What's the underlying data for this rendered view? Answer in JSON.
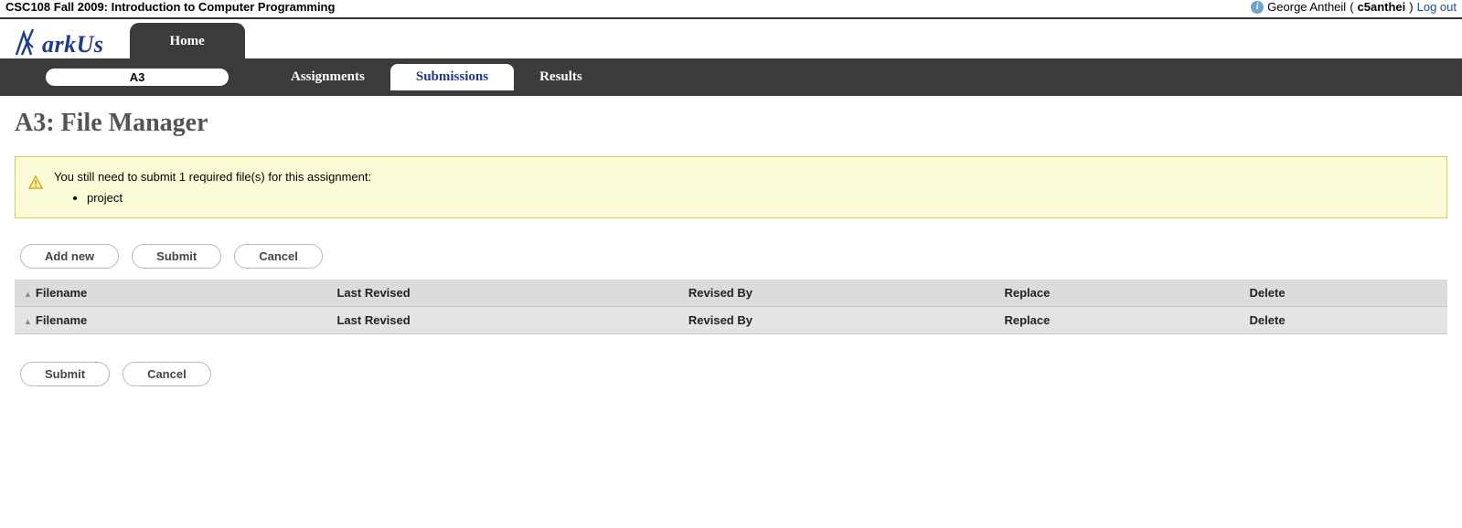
{
  "course_title": "CSC108 Fall 2009: Introduction to Computer Programming",
  "user": {
    "name": "George Antheil",
    "id": "c5anthei",
    "logout_label": "Log out"
  },
  "logo_text": "arkUs",
  "home_tab": "Home",
  "context_label": "A3",
  "nav": {
    "assignments": "Assignments",
    "submissions": "Submissions",
    "results": "Results"
  },
  "page_title": "A3: File Manager",
  "warning": {
    "message": "You still need to submit 1 required file(s) for this assignment:",
    "missing_files": [
      "project"
    ]
  },
  "buttons": {
    "add_new": "Add new",
    "submit": "Submit",
    "cancel": "Cancel"
  },
  "table": {
    "headers": {
      "filename": "Filename",
      "last_revised": "Last Revised",
      "revised_by": "Revised By",
      "replace": "Replace",
      "delete": "Delete"
    }
  }
}
